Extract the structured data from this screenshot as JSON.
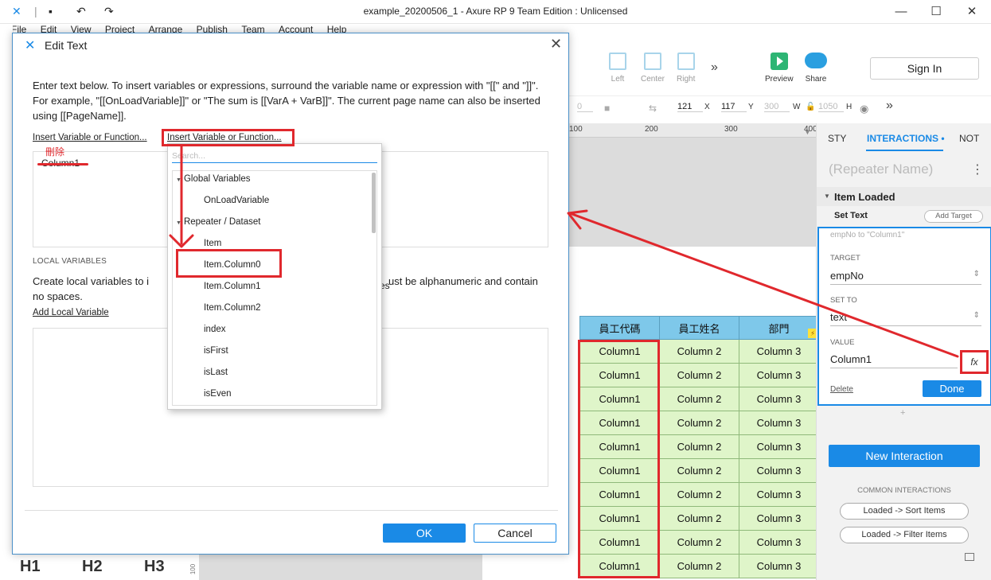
{
  "window": {
    "title": "example_20200506_1 - Axure RP 9 Team Edition : Unlicensed",
    "menu": [
      "File",
      "Edit",
      "View",
      "Project",
      "Arrange",
      "Publish",
      "Team",
      "Account",
      "Help"
    ]
  },
  "toolbar": {
    "align": [
      "Left",
      "Center",
      "Right"
    ],
    "preview_label": "Preview",
    "share_label": "Share",
    "sign_in_label": "Sign In"
  },
  "propbar": {
    "x_label": "X",
    "x_value": "121",
    "y_label": "Y",
    "y_value": "117",
    "w_label": "W",
    "w_value": "300",
    "h_label": "H",
    "h_value": "1050",
    "left_value": "0"
  },
  "ruler": [
    "100",
    "200",
    "300",
    "400"
  ],
  "canvas_bottom": {
    "headings": [
      "H1",
      "H2",
      "H3"
    ],
    "ruler_mark": "100"
  },
  "repeater": {
    "headers": [
      "員工代碼",
      "員工姓名",
      "部門"
    ],
    "rows": [
      [
        "Column1",
        "Column 2",
        "Column 3"
      ],
      [
        "Column1",
        "Column 2",
        "Column 3"
      ],
      [
        "Column1",
        "Column 2",
        "Column 3"
      ],
      [
        "Column1",
        "Column 2",
        "Column 3"
      ],
      [
        "Column1",
        "Column 2",
        "Column 3"
      ],
      [
        "Column1",
        "Column 2",
        "Column 3"
      ],
      [
        "Column1",
        "Column 2",
        "Column 3"
      ],
      [
        "Column1",
        "Column 2",
        "Column 3"
      ],
      [
        "Column1",
        "Column 2",
        "Column 3"
      ],
      [
        "Column1",
        "Column 2",
        "Column 3"
      ]
    ]
  },
  "panel": {
    "tabs": [
      "STY",
      "INTERACTIONS",
      "NOT"
    ],
    "repeater_name": "(Repeater Name)",
    "event": "Item Loaded",
    "action": "Set Text",
    "add_target": "Add Target",
    "summary": "empNo to \"Column1\"",
    "target_label": "TARGET",
    "target_value": "empNo",
    "set_to_label": "SET TO",
    "set_to_value": "text",
    "value_label": "VALUE",
    "value_value": "Column1",
    "fx_label": "fx",
    "delete_label": "Delete",
    "done_label": "Done",
    "plus": "+",
    "new_interaction": "New Interaction",
    "common_heading": "COMMON INTERACTIONS",
    "common": [
      "Loaded -> Sort Items",
      "Loaded -> Filter Items"
    ]
  },
  "dialog": {
    "title": "Edit Text",
    "instructions": "Enter text below. To insert variables or expressions, surround the variable name or expression with \"[[\" and \"]]\". For example, \"[[OnLoadVariable]]\" or \"The sum is [[VarA + VarB]]\". The current page name can also be inserted using [[PageName]].",
    "insert_link_1": "Insert Variable or Function...",
    "insert_link_2": "Insert Variable or Function...",
    "text_value": "Column1",
    "delete_note": "刪除",
    "local_heading": "LOCAL VARIABLES",
    "local_desc_left": "Create local variables to i",
    "local_desc_right": "ust be alphanumeric and contain",
    "local_desc_line2": "no spaces.",
    "local_desc_fragment": "es",
    "add_local": "Add Local Variable",
    "ok_label": "OK",
    "cancel_label": "Cancel"
  },
  "dropdown": {
    "search_placeholder": "Search...",
    "groups": [
      {
        "label": "Global Variables",
        "items": [
          "OnLoadVariable"
        ]
      },
      {
        "label": "Repeater / Dataset",
        "items": [
          "Item",
          "Item.Column0",
          "Item.Column1",
          "Item.Column2",
          "index",
          "isFirst",
          "isLast",
          "isEven"
        ]
      }
    ]
  },
  "colors": {
    "accent": "#1a8ae6",
    "annotation": "#e0282d",
    "header_cell": "#7ec8ea",
    "body_cell": "#dff5c9"
  }
}
